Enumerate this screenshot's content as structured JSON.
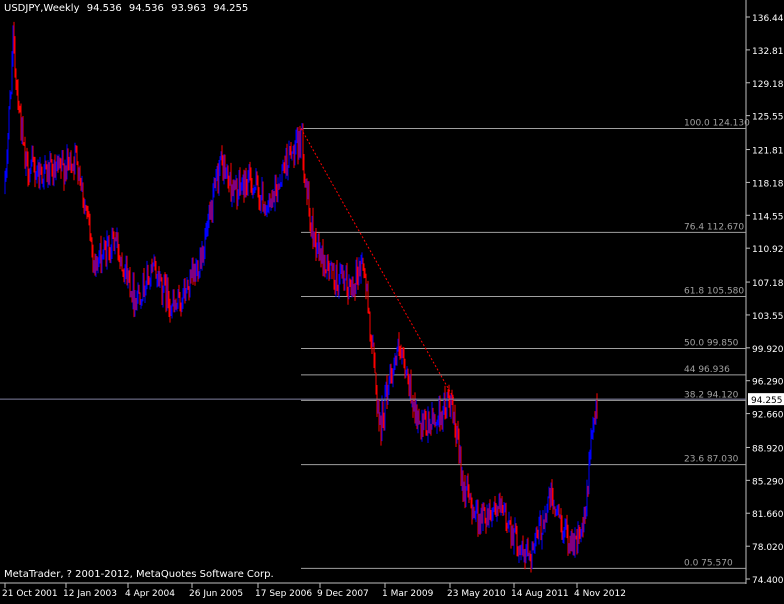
{
  "header": {
    "symbol": "USDJPY,Weekly",
    "open": "94.536",
    "high": "94.536",
    "low": "93.963",
    "close": "94.255"
  },
  "copyright": "MetaTrader, ? 2001-2012, MetaQuotes Software Corp.",
  "colors": {
    "background": "#000000",
    "axis": "#c0c0c0",
    "bull_candle": "#0000ff",
    "bear_candle": "#ff0000",
    "fib_line": "#a0a0a0",
    "trend_line": "#ff0000",
    "text": "#ffffff",
    "price_tag_bg": "#ffffff",
    "price_tag_text": "#000000"
  },
  "chart_data": {
    "type": "candlestick",
    "symbol": "USDJPY",
    "timeframe": "Weekly",
    "current_price": "94.255",
    "y_ticks": [
      "136.440",
      "132.810",
      "129.180",
      "125.550",
      "121.810",
      "118.180",
      "114.550",
      "110.920",
      "107.180",
      "103.550",
      "99.920",
      "96.290",
      "92.660",
      "88.920",
      "85.290",
      "81.660",
      "78.020",
      "74.400"
    ],
    "x_ticks": [
      "21 Oct 2001",
      "12 Jan 2003",
      "4 Apr 2004",
      "26 Jun 2005",
      "17 Sep 2006",
      "9 Dec 2007",
      "1 Mar 2009",
      "23 May 2010",
      "14 Aug 2011",
      "4 Nov 2012"
    ],
    "ylim": [
      74.4,
      136.44
    ],
    "anchor_points": [
      [
        0,
        117.5
      ],
      [
        8,
        133.5
      ],
      [
        20,
        120
      ],
      [
        32,
        119.5
      ],
      [
        50,
        119
      ],
      [
        72,
        121
      ],
      [
        90,
        109
      ],
      [
        110,
        112
      ],
      [
        130,
        105.5
      ],
      [
        150,
        108.5
      ],
      [
        170,
        104
      ],
      [
        190,
        108
      ],
      [
        205,
        113.8
      ],
      [
        215,
        120.5
      ],
      [
        230,
        117
      ],
      [
        245,
        118.5
      ],
      [
        265,
        115
      ],
      [
        280,
        120.5
      ],
      [
        293,
        121.8
      ],
      [
        296,
        124.1
      ],
      [
        305,
        113.5
      ],
      [
        318,
        109.5
      ],
      [
        330,
        107.5
      ],
      [
        345,
        106.5
      ],
      [
        358,
        109.5
      ],
      [
        365,
        102.5
      ],
      [
        375,
        91
      ],
      [
        385,
        97
      ],
      [
        393,
        99.5
      ],
      [
        405,
        95.5
      ],
      [
        415,
        90.5
      ],
      [
        430,
        92
      ],
      [
        445,
        94.1
      ],
      [
        460,
        84
      ],
      [
        475,
        81
      ],
      [
        490,
        82.5
      ],
      [
        505,
        80.5
      ],
      [
        518,
        77
      ],
      [
        530,
        78
      ],
      [
        545,
        83.5
      ],
      [
        560,
        79.5
      ],
      [
        572,
        78.5
      ],
      [
        580,
        80.5
      ],
      [
        585,
        88
      ],
      [
        592,
        94.3
      ]
    ],
    "last_index": 592,
    "fibonacci": {
      "levels": [
        {
          "ratio": "100.0",
          "price": "124.130",
          "value": 124.13
        },
        {
          "ratio": "76.4",
          "price": "112.670",
          "value": 112.67
        },
        {
          "ratio": "61.8",
          "price": "105.580",
          "value": 105.58
        },
        {
          "ratio": "50.0",
          "price": "99.850",
          "value": 99.85
        },
        {
          "ratio": "44",
          "price": "96.936",
          "value": 96.936
        },
        {
          "ratio": "38.2",
          "price": "94.120",
          "value": 94.12
        },
        {
          "ratio": "23.6",
          "price": "87.030",
          "value": 87.03
        },
        {
          "ratio": "0.0",
          "price": "75.570",
          "value": 75.57
        }
      ],
      "start_index": 296
    },
    "trendline": {
      "from": [
        296,
        124.13
      ],
      "to": [
        450,
        94.12
      ]
    }
  }
}
